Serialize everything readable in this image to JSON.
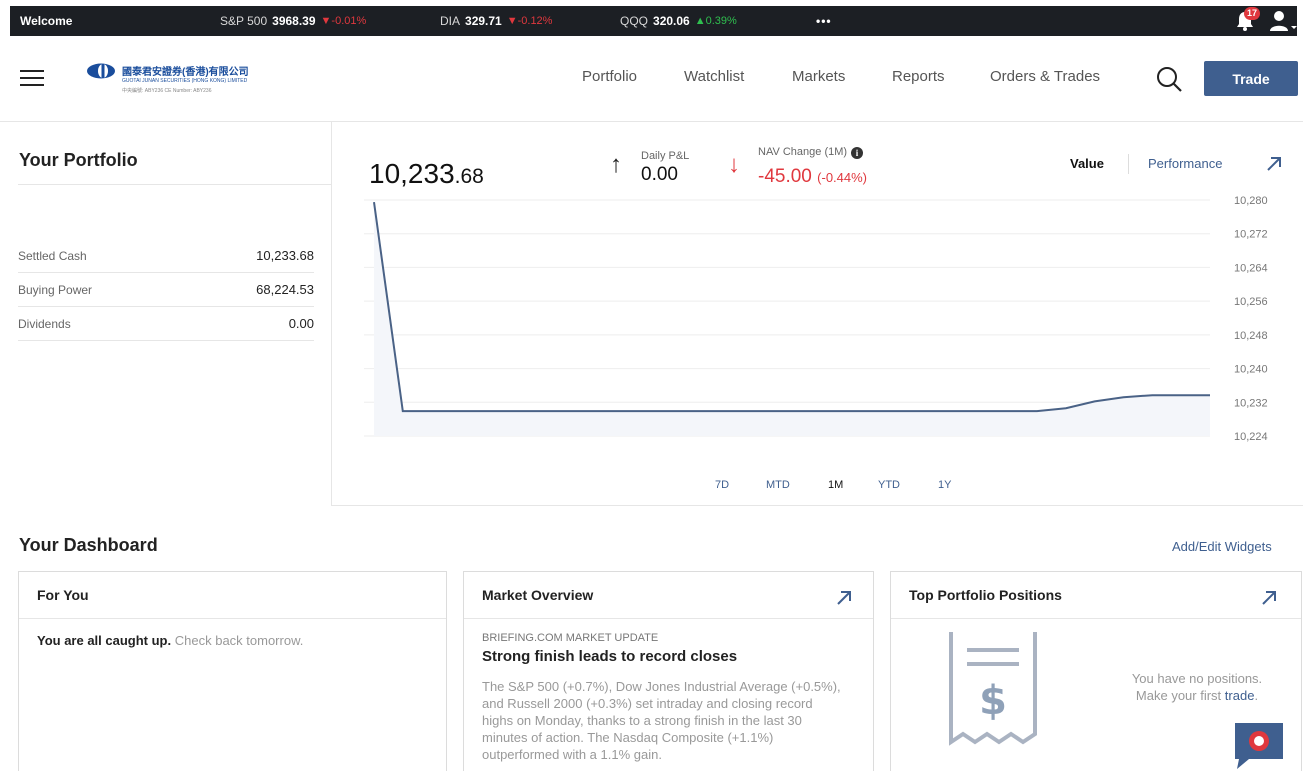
{
  "ticker": {
    "welcome": "Welcome",
    "items": [
      {
        "symbol": "S&P 500",
        "price": "3968.39",
        "change": "▼-0.01%",
        "direction": "down"
      },
      {
        "symbol": "DIA",
        "price": "329.71",
        "change": "▼-0.12%",
        "direction": "down"
      },
      {
        "symbol": "QQQ",
        "price": "320.06",
        "change": "▲0.39%",
        "direction": "up"
      }
    ],
    "more": "•••",
    "notification_count": "17"
  },
  "header": {
    "logo_cn": "國泰君安證券(香港)有限公司",
    "logo_en": "GUOTAI JUNAN SECURITIES (HONG KONG) LIMITED",
    "logo_sub": "中央編號: ABY236  CE Number: ABY236",
    "nav": [
      "Portfolio",
      "Watchlist",
      "Markets",
      "Reports",
      "Orders & Trades"
    ],
    "trade_label": "Trade"
  },
  "portfolio": {
    "title": "Your Portfolio",
    "rows": [
      {
        "label": "Settled Cash",
        "value": "10,233.68"
      },
      {
        "label": "Buying Power",
        "value": "68,224.53"
      },
      {
        "label": "Dividends",
        "value": "0.00"
      }
    ]
  },
  "nav_panel": {
    "nav_int": "10,233",
    "nav_dec": ".68",
    "daily_label": "Daily P&L",
    "daily_value": "0.00",
    "change_label": "NAV Change (1M)",
    "change_value": "-45.00",
    "change_pct": "(-0.44%)",
    "toggle_value": "Value",
    "toggle_performance": "Performance",
    "periods": [
      "7D",
      "MTD",
      "1M",
      "YTD",
      "1Y"
    ],
    "active_period": "1M"
  },
  "chart_data": {
    "type": "line",
    "ylim": [
      10220,
      10284
    ],
    "y_ticks": [
      "10,280",
      "10,272",
      "10,264",
      "10,256",
      "10,248",
      "10,240",
      "10,232",
      "10,224"
    ],
    "y_tick_values": [
      10280,
      10272,
      10264,
      10256,
      10248,
      10240,
      10232,
      10224
    ],
    "grid": true,
    "series": [
      {
        "values": [
          10279.5,
          10229.9,
          10229.9,
          10229.9,
          10229.9,
          10229.9,
          10229.9,
          10229.9,
          10229.9,
          10229.9,
          10229.9,
          10229.9,
          10229.9,
          10229.9,
          10229.9,
          10229.9,
          10229.9,
          10229.9,
          10229.9,
          10229.9,
          10229.9,
          10229.9,
          10229.9,
          10229.9,
          10230.6,
          10232.2,
          10233.2,
          10233.68,
          10233.68,
          10233.68
        ]
      }
    ],
    "line_color": "#4a6286"
  },
  "dashboard": {
    "title": "Your Dashboard",
    "add_widgets": "Add/Edit Widgets",
    "for_you": {
      "title": "For You",
      "bold": "You are all caught up.",
      "muted": "Check back tomorrow."
    },
    "market_overview": {
      "title": "Market Overview",
      "source": "BRIEFING.COM MARKET UPDATE",
      "headline": "Strong finish leads to record closes",
      "body": "The S&P 500 (+0.7%), Dow Jones Industrial Average (+0.5%), and Russell 2000 (+0.3%) set intraday and closing record highs on Monday, thanks to a strong finish in the last 30 minutes of action. The Nasdaq Composite (+1.1%) outperformed with a 1.1% gain."
    },
    "top_positions": {
      "title": "Top Portfolio Positions",
      "line1": "You have no positions.",
      "line2": "Make your first",
      "link": "trade",
      "tail": "."
    }
  },
  "colors": {
    "accent": "#3f5f8f",
    "negative": "#e0383e",
    "positive": "#2fbf4f",
    "ticker_bg": "#1c1f24"
  }
}
